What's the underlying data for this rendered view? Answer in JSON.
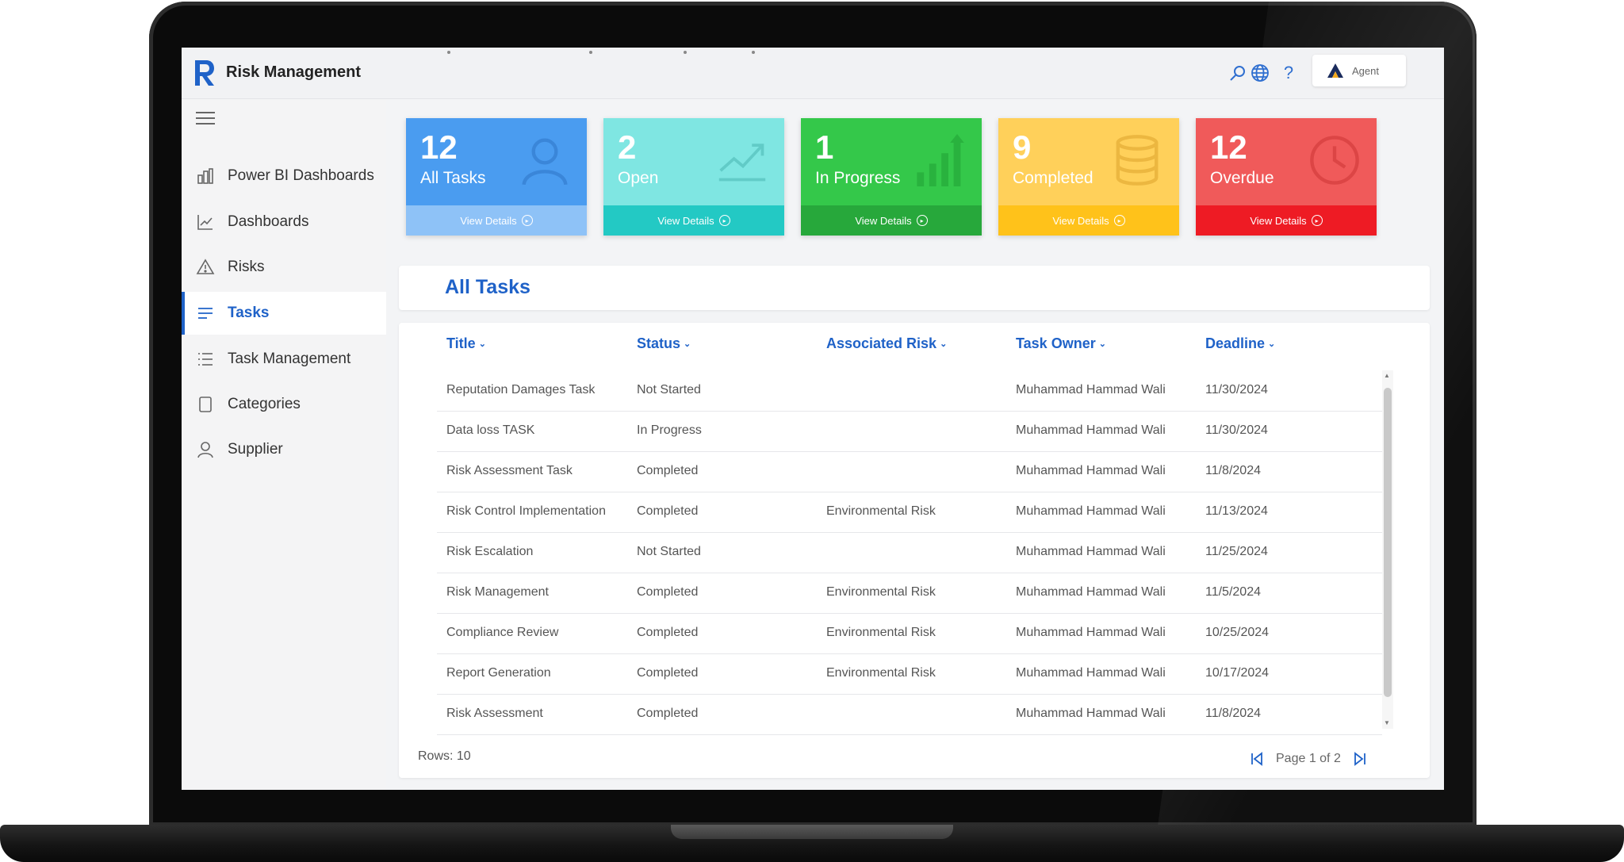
{
  "app": {
    "title": "Risk Management",
    "agent_label": "Agent"
  },
  "colors": {
    "accent": "#1f62c8",
    "card_all": "#4a9cf0",
    "card_open": "#7fe6e2",
    "card_inprogress": "#34c84a",
    "card_completed": "#ffd05a",
    "card_overdue": "#f05a5a"
  },
  "sidebar": {
    "items": [
      {
        "label": "Power BI Dashboards",
        "icon": "bar-chart-icon"
      },
      {
        "label": "Dashboards",
        "icon": "line-chart-icon"
      },
      {
        "label": "Risks",
        "icon": "warning-icon"
      },
      {
        "label": "Tasks",
        "icon": "list-icon",
        "active": true
      },
      {
        "label": "Task Management",
        "icon": "checklist-icon"
      },
      {
        "label": "Categories",
        "icon": "page-icon"
      },
      {
        "label": "Supplier",
        "icon": "person-icon"
      }
    ]
  },
  "cards": [
    {
      "value": "12",
      "label": "All Tasks",
      "footer": "View Details",
      "icon": "user-icon"
    },
    {
      "value": "2",
      "label": "Open",
      "footer": "View Details",
      "icon": "trend-icon"
    },
    {
      "value": "1",
      "label": "In Progress",
      "footer": "View Details",
      "icon": "bars-up-icon"
    },
    {
      "value": "9",
      "label": "Completed",
      "footer": "View Details",
      "icon": "database-icon"
    },
    {
      "value": "12",
      "label": "Overdue",
      "footer": "View Details",
      "icon": "clock-icon"
    }
  ],
  "tasks": {
    "title": "All Tasks",
    "columns": [
      "Title",
      "Status",
      "Associated Risk",
      "Task Owner",
      "Deadline"
    ],
    "rows": [
      [
        "Reputation Damages Task",
        "Not Started",
        "",
        "Muhammad Hammad Wali",
        "11/30/2024"
      ],
      [
        "Data loss TASK",
        "In Progress",
        "",
        "Muhammad Hammad Wali",
        "11/30/2024"
      ],
      [
        "Risk Assessment Task",
        "Completed",
        "",
        "Muhammad Hammad Wali",
        "11/8/2024"
      ],
      [
        "Risk Control Implementation",
        "Completed",
        "Environmental Risk",
        "Muhammad Hammad Wali",
        "11/13/2024"
      ],
      [
        "Risk Escalation",
        "Not Started",
        "",
        "Muhammad Hammad Wali",
        "11/25/2024"
      ],
      [
        "Risk Management",
        "Completed",
        "Environmental Risk",
        "Muhammad Hammad Wali",
        "11/5/2024"
      ],
      [
        "Compliance Review",
        "Completed",
        "Environmental Risk",
        "Muhammad Hammad Wali",
        "10/25/2024"
      ],
      [
        "Report Generation",
        "Completed",
        "Environmental Risk",
        "Muhammad Hammad Wali",
        "10/17/2024"
      ],
      [
        "Risk Assessment",
        "Completed",
        "",
        "Muhammad Hammad Wali",
        "11/8/2024"
      ]
    ],
    "rows_label": "Rows: 10",
    "page_label": "Page 1 of 2"
  }
}
